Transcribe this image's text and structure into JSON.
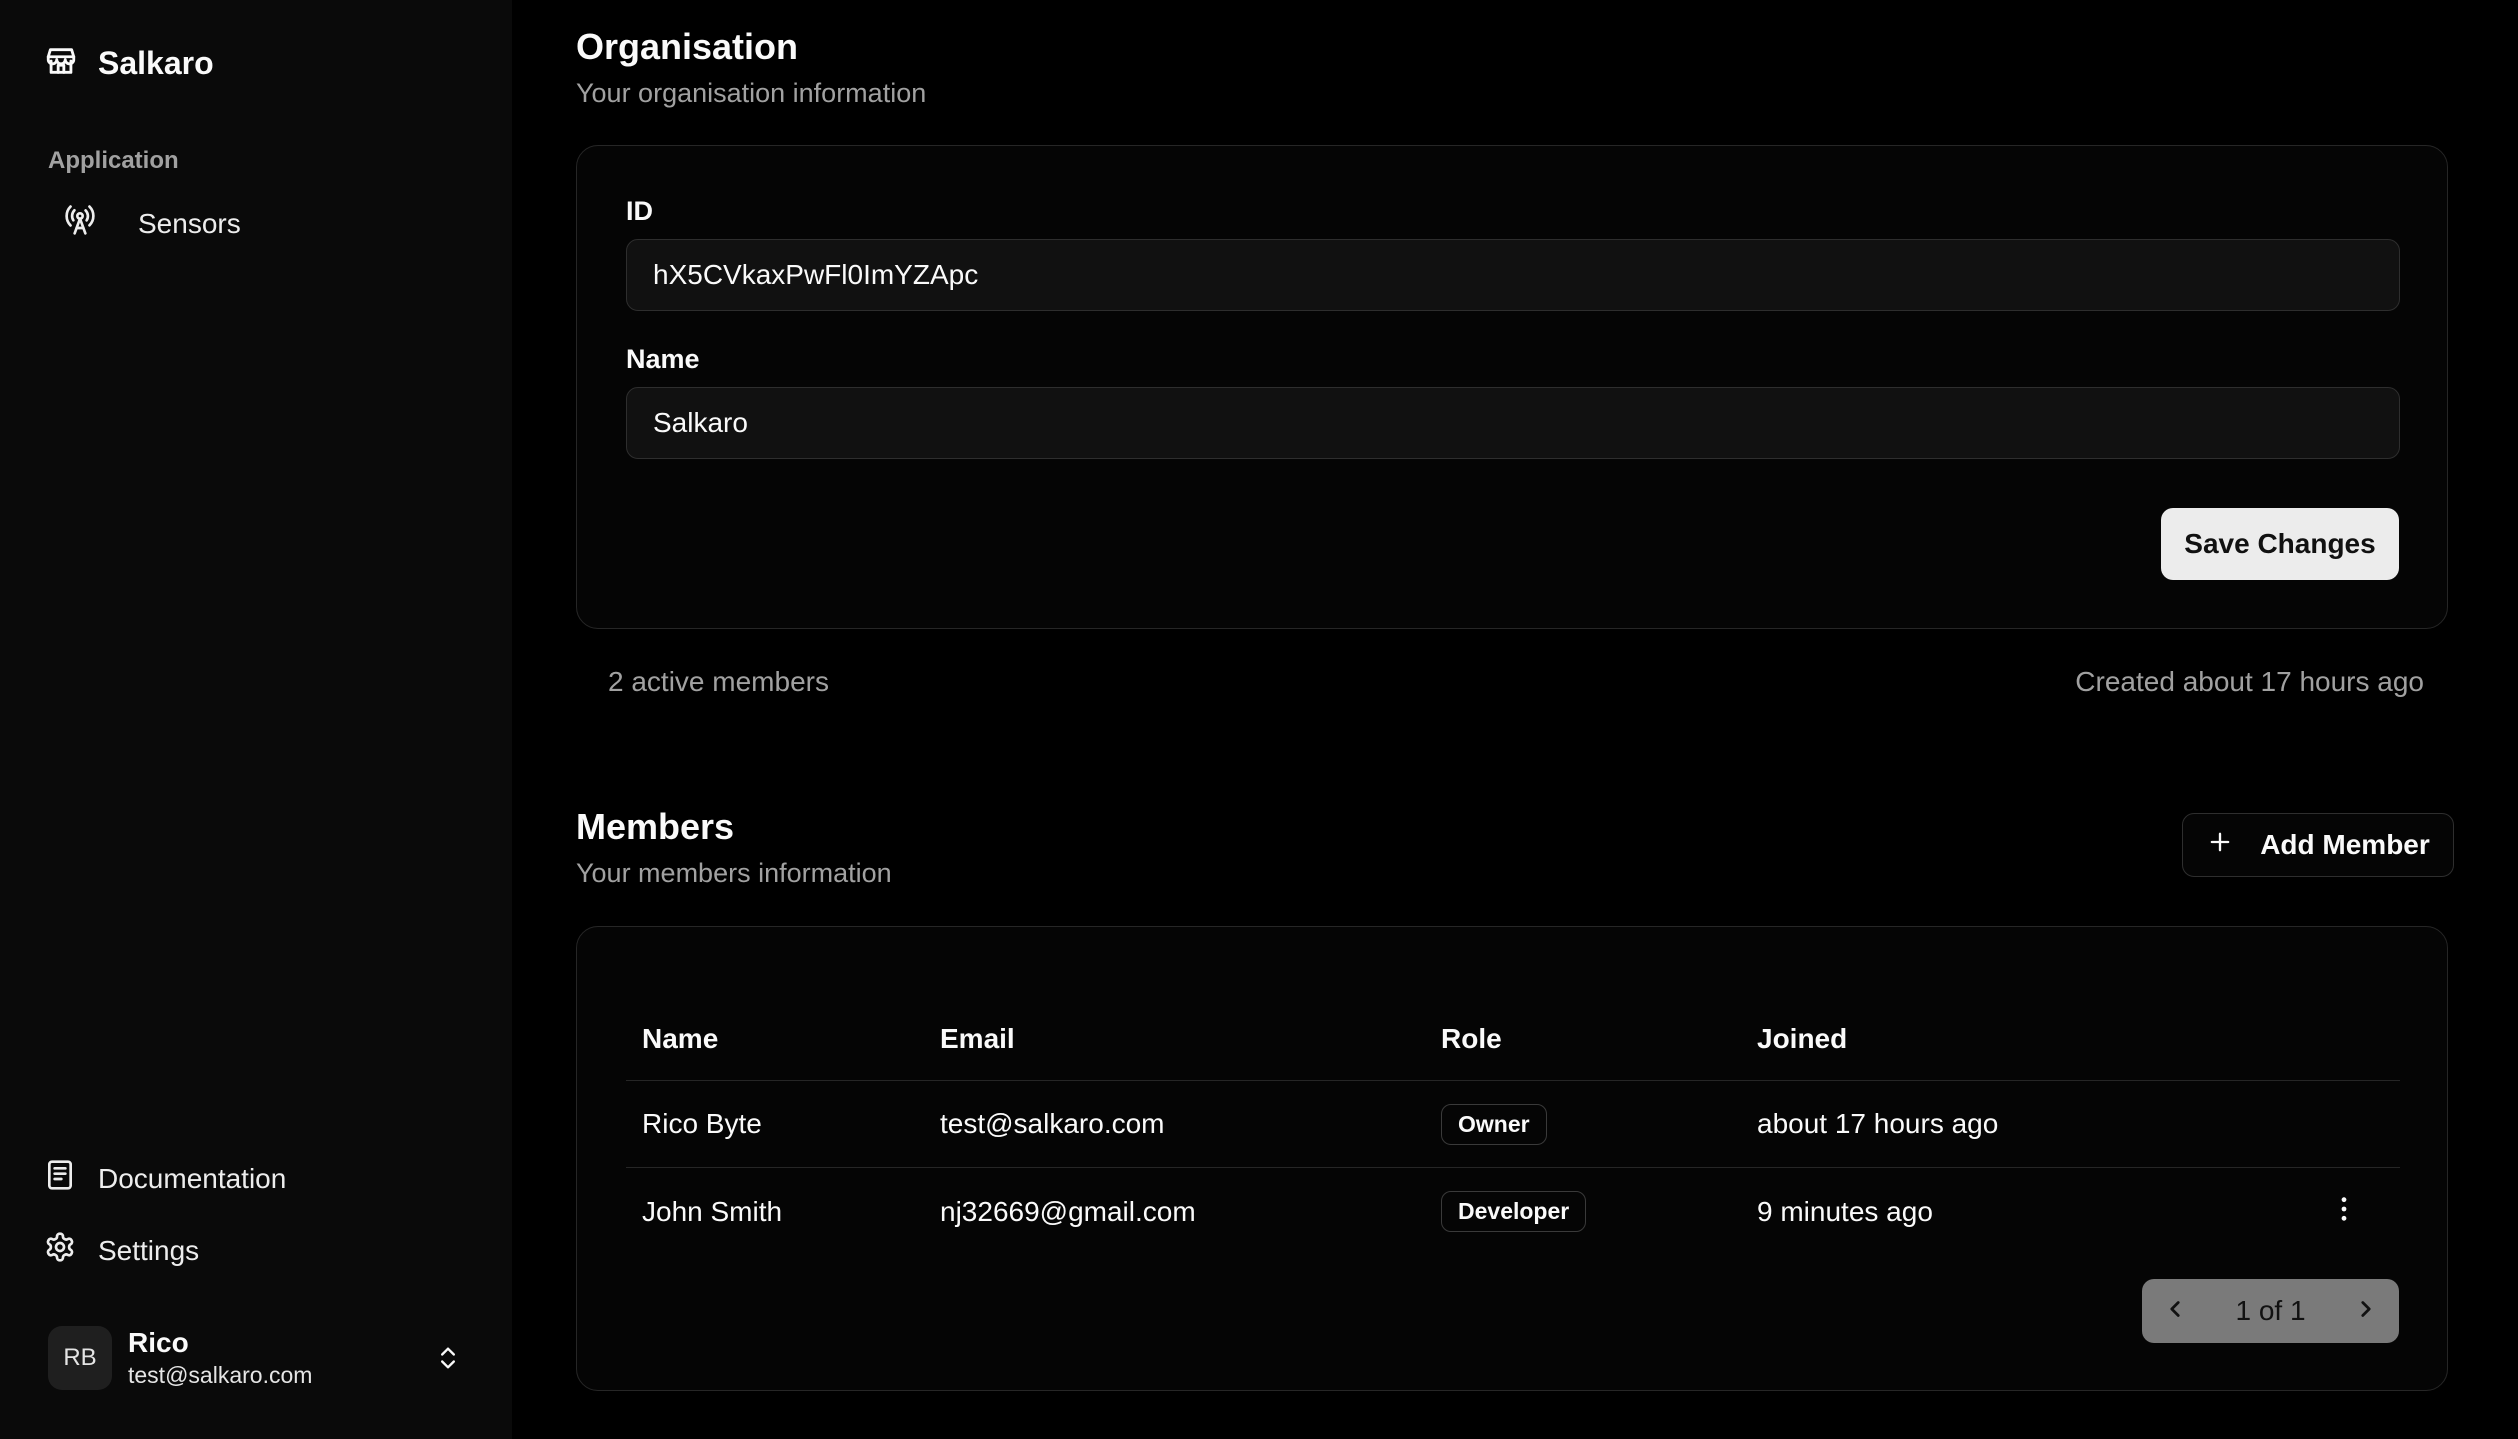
{
  "sidebar": {
    "brand": "Salkaro",
    "group_label": "Application",
    "nav_sensors": "Sensors",
    "nav_documentation": "Documentation",
    "nav_settings": "Settings",
    "user": {
      "initials": "RB",
      "name": "Rico",
      "email": "test@salkaro.com"
    }
  },
  "organisation": {
    "title": "Organisation",
    "subtitle": "Your organisation information",
    "id_label": "ID",
    "id_value": "hX5CVkaxPwFl0ImYZApc",
    "name_label": "Name",
    "name_value": "Salkaro",
    "save_label": "Save Changes",
    "active_members": "2 active members",
    "created": "Created about 17 hours ago"
  },
  "members": {
    "title": "Members",
    "subtitle": "Your members information",
    "add_label": "Add Member",
    "columns": {
      "name": "Name",
      "email": "Email",
      "role": "Role",
      "joined": "Joined"
    },
    "rows": [
      {
        "name": "Rico Byte",
        "email": "test@salkaro.com",
        "role": "Owner",
        "joined": "about 17 hours ago"
      },
      {
        "name": "John Smith",
        "email": "nj32669@gmail.com",
        "role": "Developer",
        "joined": "9 minutes ago"
      }
    ],
    "pagination": "1 of 1"
  },
  "icons": {
    "brand": "store-icon",
    "sensors": "antenna-icon",
    "documentation": "book-icon",
    "settings": "gear-icon",
    "user_menu": "chevrons-up-down-icon",
    "add": "plus-icon",
    "row_actions": "more-vertical-icon",
    "prev": "chevron-left-icon",
    "next": "chevron-right-icon"
  },
  "colors": {
    "background": "#000000",
    "sidebar": "#0a0a0a",
    "border": "#262626",
    "muted_text": "#a1a1a1",
    "primary_button": "#ececec"
  }
}
